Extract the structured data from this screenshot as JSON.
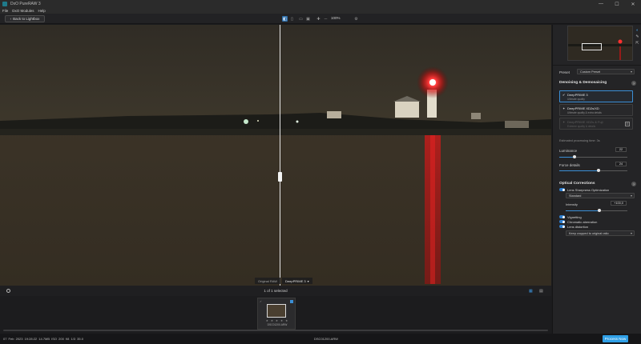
{
  "window": {
    "title": "DxO PureRAW 3",
    "controls": [
      "—",
      "☐",
      "✕"
    ]
  },
  "menu": [
    "File",
    "DxO Modules",
    "Help"
  ],
  "toolbar": {
    "back_label": "Back to Lightbox",
    "zoom_value": "100%"
  },
  "viewer": {
    "label_original": "Original RAW",
    "label_processed": "DeepPRIME 3"
  },
  "panel": {
    "preset_label": "Preset",
    "preset_value": "Custom Preset",
    "denoise_title": "Denoising & Demosaicing",
    "modes": [
      {
        "title": "DeepPRIME 3",
        "subtitle": "Ultimate quality",
        "state": "selected"
      },
      {
        "title": "DeepPRIME XD2s/XD",
        "subtitle": "Ultimate quality & extra details",
        "state": "normal"
      },
      {
        "title": "DeepPRIME XD2s & Fuji",
        "subtitle": "Extreme quality & details",
        "state": "disabled"
      }
    ],
    "estimate_text": "Estimated processing time: 3s",
    "luminance_label": "Luminance",
    "luminance_value": 22,
    "force_details_label": "Force details",
    "force_details_value": 24,
    "optical_title": "Optical Corrections",
    "lens_sharpness_label": "Lens Sharpness Optimization",
    "lens_sharpness_mode": "Standard",
    "intensity_label": "Intensity",
    "intensity_value": "+100,0",
    "toggles": [
      "Vignetting",
      "Chromatic aberration",
      "Lens distortion"
    ],
    "distortion_mode": "Keep cropped to original ratio"
  },
  "filmstrip": {
    "selection_count": "1 of 1 selected",
    "thumb_name": "DSC01200.ARW",
    "thumb_flag": "✓",
    "stars": "★ ★ ★ ★ ★"
  },
  "status": {
    "meta": "07 Feb 2023 19:28:22  14.7MB  ISO 200  f/8  1/3  35.0",
    "filename": "DSC01200.ARW",
    "process_label": "Process Now"
  },
  "colors": {
    "accent": "#2f9fe6",
    "selected_border": "#3b8fd6",
    "background": "#1b1b1d"
  },
  "slider_levels": {
    "luminance": 0.22,
    "force_details": 0.58,
    "intensity": 0.55
  }
}
